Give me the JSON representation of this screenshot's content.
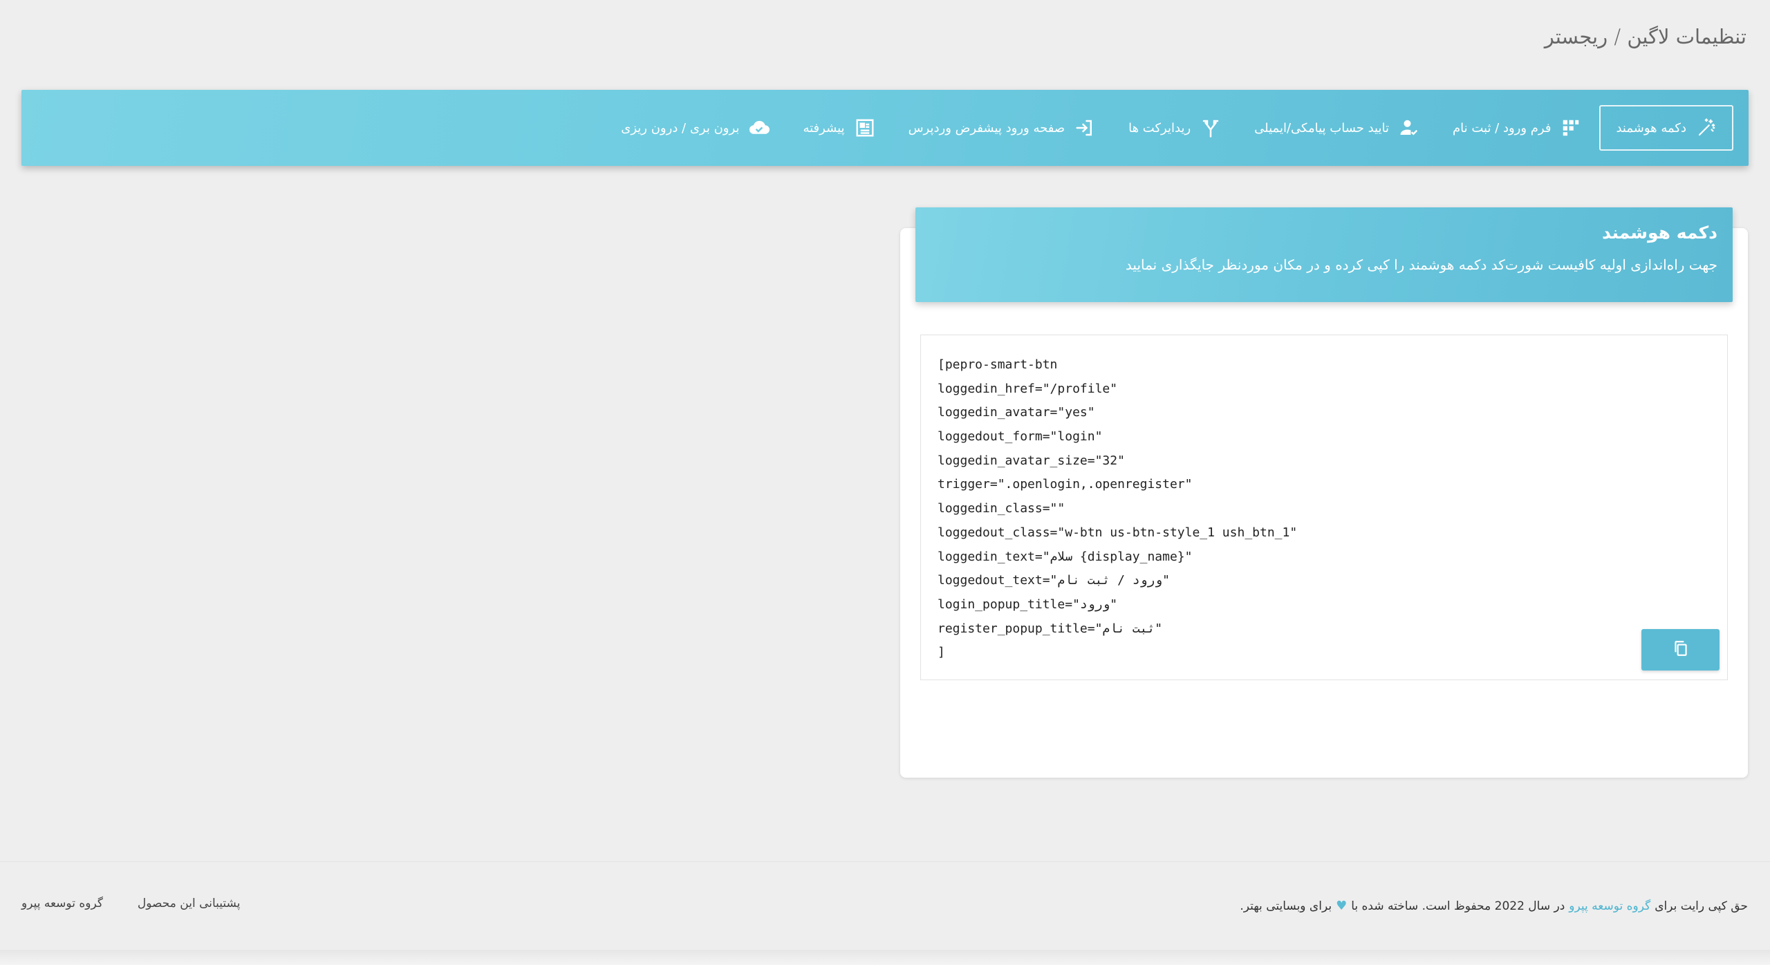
{
  "page": {
    "title": "تنظیمات لاگین / ریجستر"
  },
  "nav": {
    "items": [
      {
        "label": "دکمه هوشمند",
        "icon": "magic-wand-icon",
        "active": true
      },
      {
        "label": "فرم ورود / ثبت نام",
        "icon": "grid-icon",
        "active": false
      },
      {
        "label": "تایید حساب پیامکی/ایمیلی",
        "icon": "user-check-icon",
        "active": false
      },
      {
        "label": "ریدایرکت ها",
        "icon": "redirect-icon",
        "active": false
      },
      {
        "label": "صفحه ورود پیشفرض وردپرس",
        "icon": "login-icon",
        "active": false
      },
      {
        "label": "پیشرفته",
        "icon": "advanced-icon",
        "active": false
      },
      {
        "label": "برون بری / درون ریزی",
        "icon": "cloud-check-icon",
        "active": false
      }
    ]
  },
  "card": {
    "title": "دکمه هوشمند",
    "description": "جهت راه‌اندازی اولیه کافیست شورت‌کد دکمه هوشمند را کپی کرده و در مکان موردنظر جایگذاری نمایید",
    "code_lines": [
      "[pepro-smart-btn",
      "loggedin_href=\"/profile\"",
      "loggedin_avatar=\"yes\"",
      "loggedout_form=\"login\"",
      "loggedin_avatar_size=\"32\"",
      "trigger=\".openlogin,.openregister\"",
      "loggedin_class=\"\"",
      "loggedout_class=\"w-btn us-btn-style_1 ush_btn_1\"",
      "loggedin_text=\"سلام {display_name}\"",
      "loggedout_text=\"ورود / ثبت نام\"",
      "login_popup_title=\"ورود\"",
      "register_popup_title=\"ثبت نام\"",
      "]"
    ],
    "copy_icon": "copy-icon"
  },
  "footer": {
    "copyright_prefix": "حق کپی رایت برای",
    "copyright_link": "گروه توسعه پپرو",
    "copyright_middle": "در سال 2022 محفوظ است. ساخته شده با",
    "copyright_suffix": "برای وبسایتی بهتر.",
    "heart_icon": "heart-icon",
    "links": [
      "گروه توسعه پپرو",
      "پشتیبانی این محصول"
    ]
  },
  "colors": {
    "accent": "#5bbbd4",
    "background": "#eeeeee"
  }
}
